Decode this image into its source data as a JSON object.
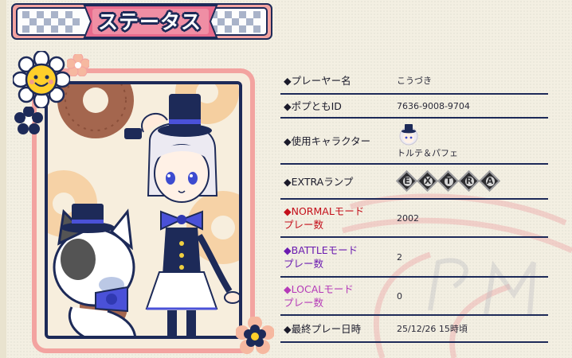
{
  "header": {
    "title": "ステータス"
  },
  "portrait": {
    "character_name": "トルテ＆パフェ"
  },
  "status": {
    "rows": [
      {
        "label": "◆プレーヤー名",
        "value": "こうづき"
      },
      {
        "label": "◆ポプともID",
        "value": "7636-9008-9704"
      },
      {
        "label": "◆使用キャラクター",
        "value": "トルテ＆パフェ"
      },
      {
        "label": "◆EXTRAランプ",
        "value": ""
      },
      {
        "label": "◆NORMALモード\nプレー数",
        "value": "2002"
      },
      {
        "label": "◆BATTLEモード\nプレー数",
        "value": "2"
      },
      {
        "label": "◆LOCALモード\nプレー数",
        "value": "0"
      },
      {
        "label": "◆最終プレー日時",
        "value": "25/12/26 15時頃"
      }
    ],
    "extra_lamp_letters": [
      "E",
      "X",
      "T",
      "R",
      "A"
    ]
  },
  "colors": {
    "navy": "#1d2a58",
    "pink_frame": "#f3a3a0",
    "normal": "#c40f1a",
    "battle": "#6b1bb0",
    "local": "#b53ab8",
    "background": "#f3efe2"
  },
  "icons": [
    "sun-flower-icon",
    "orange-flower-icon",
    "navy-flower-icon",
    "character-avatar-icon",
    "extra-lamp-icon"
  ]
}
